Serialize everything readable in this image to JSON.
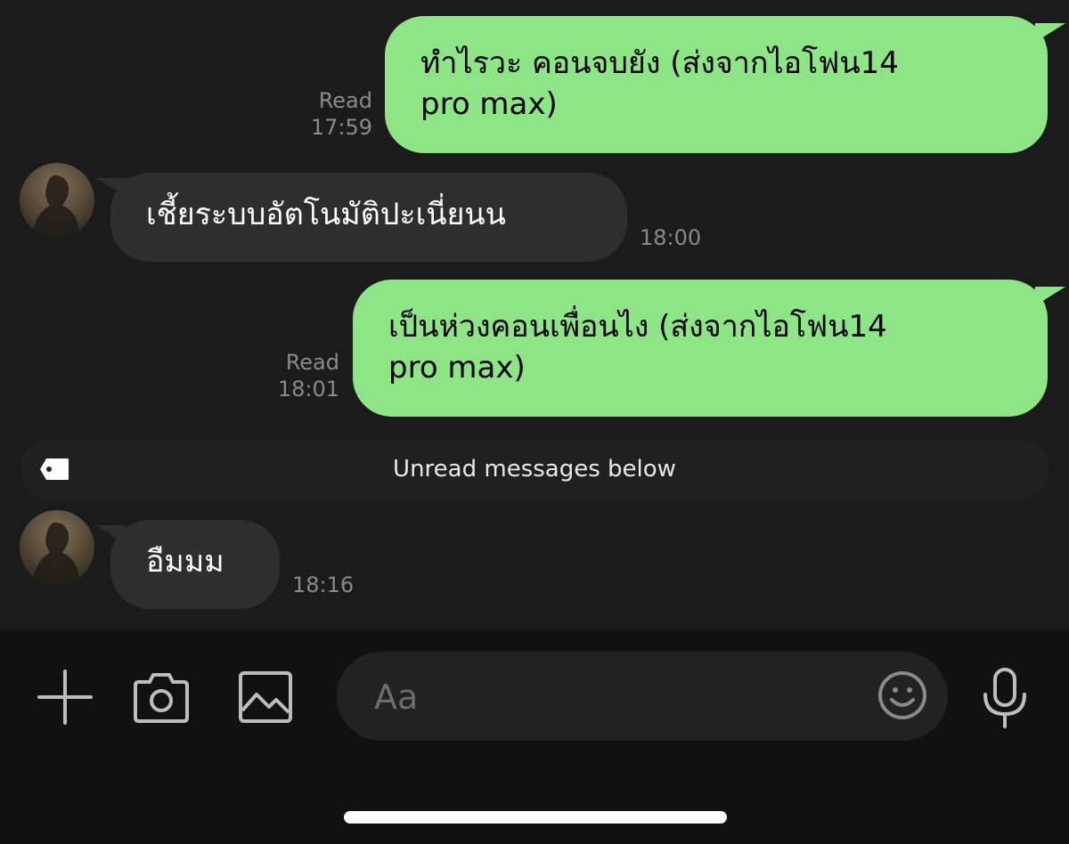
{
  "messages": [
    {
      "text": "ทำไรวะ คอนจบยัง (ส่งจากไอโฟน14\npro max)",
      "status": "Read",
      "time": "17:59"
    },
    {
      "text": "เชี้ยระบบอัตโนมัติปะเนี่ยนน",
      "time": "18:00"
    },
    {
      "text": "เป็นห่วงคอนเพื่อนไง (ส่งจากไอโฟน14\npro max)",
      "status": "Read",
      "time": "18:01"
    },
    {
      "text": "อืมมม",
      "time": "18:16"
    }
  ],
  "unread_banner": {
    "label": "Unread messages below",
    "icon": "tag-icon"
  },
  "composer": {
    "placeholder": "Aa"
  },
  "toolbar": {
    "icons": [
      "plus-icon",
      "camera-icon",
      "image-icon",
      "emoji-icon",
      "microphone-icon"
    ]
  },
  "colors": {
    "background": "#1b1b1b",
    "outgoing_bubble": "#8de585",
    "incoming_bubble": "#2e2e2e",
    "meta_text": "#8a8a8a",
    "input_bar": "#111111"
  }
}
